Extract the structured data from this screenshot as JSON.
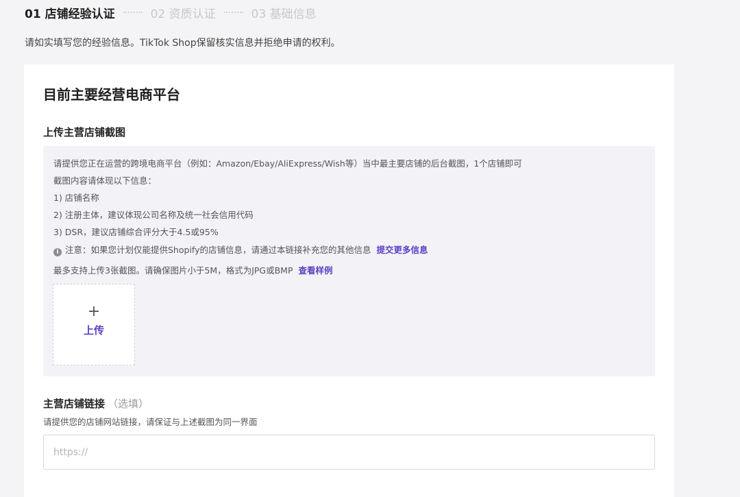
{
  "steps": [
    {
      "label": "01 店铺经验认证",
      "active": true
    },
    {
      "label": "02 资质认证",
      "active": false
    },
    {
      "label": "03 基础信息",
      "active": false
    }
  ],
  "intro": "请如实填写您的经验信息。TikTok Shop保留核实信息并拒绝申请的权利。",
  "section_title": "目前主要经营电商平台",
  "upload": {
    "title": "上传主营店铺截图",
    "lines": [
      "请提供您正在运营的跨境电商平台（例如：Amazon/Ebay/AliExpress/Wish等）当中最主要店铺的后台截图，1个店铺即可",
      "截图内容请体现以下信息：",
      "1) 店铺名称",
      "2) 注册主体，建议体现公司名称及统一社会信用代码",
      "3) DSR，建议店铺综合评分大于4.5或95%"
    ],
    "note_icon": "i",
    "note": "注意：如果您计划仅能提供Shopify的店铺信息，请通过本链接补充您的其他信息",
    "note_link": "提交更多信息",
    "limit": "最多支持上传3张截图。请确保图片小于5M，格式为JPG或BMP",
    "sample_link": "查看样例",
    "upload_plus": "+",
    "upload_label": "上传"
  },
  "store_link": {
    "title": "主营店铺链接",
    "optional": "（选填）",
    "desc": "请提供您的店铺网站链接，请保证与上述截图为同一界面",
    "placeholder": "https://",
    "value": ""
  },
  "colors": {
    "accent": "#5b3fc4",
    "page_bg": "#f4f4f6",
    "info_bg": "#f3f2f7"
  }
}
